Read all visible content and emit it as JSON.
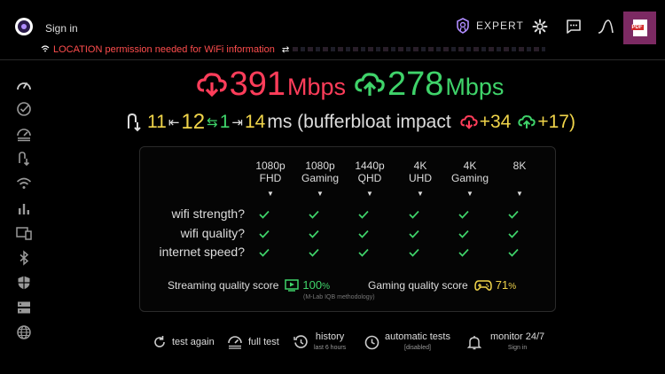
{
  "header": {
    "signin_label": "Sign in",
    "permission_warning": "LOCATION permission needed for WiFi information",
    "expert_label": "EXPERT",
    "pdf_label": "PDF"
  },
  "speeds": {
    "download": {
      "value": "391",
      "unit": "Mbps",
      "color": "#ff3d5a"
    },
    "upload": {
      "value": "278",
      "unit": "Mbps",
      "color": "#3fd36a"
    }
  },
  "latency": {
    "idle": "11",
    "min": "12",
    "jitter": "1",
    "max": "14",
    "unit_text": "ms (bufferbloat impact",
    "down_impact": "+34",
    "up_impact": "+17)"
  },
  "quality": {
    "columns": [
      {
        "line1": "1080p",
        "line2": "FHD"
      },
      {
        "line1": "1080p",
        "line2": "Gaming"
      },
      {
        "line1": "1440p",
        "line2": "QHD"
      },
      {
        "line1": "4K",
        "line2": "UHD"
      },
      {
        "line1": "4K",
        "line2": "Gaming"
      },
      {
        "line1": "8K",
        "line2": ""
      }
    ],
    "rows": [
      "wifi strength?",
      "wifi quality?",
      "internet speed?"
    ],
    "streaming_label": "Streaming quality score",
    "streaming_value": "100",
    "gaming_label": "Gaming quality score",
    "gaming_value": "71",
    "percent": "%",
    "methodology": "(M-Lab IQB methodology)",
    "check_color": "#3fd36a"
  },
  "toolbar": {
    "test_again": "test again",
    "full_test": "full test",
    "history": "history",
    "history_sub": "last 6 hours",
    "automatic_tests": "automatic tests",
    "automatic_sub": "[disabled]",
    "monitor": "monitor 24/7",
    "monitor_sub": "Sign in"
  },
  "sidebar_icons": [
    "speedometer-icon",
    "check-circle-icon",
    "gauge-icon",
    "ping-icon",
    "wifi-icon",
    "bar-chart-icon",
    "devices-icon",
    "bluetooth-icon",
    "shield-icon",
    "server-icon",
    "globe-icon"
  ]
}
